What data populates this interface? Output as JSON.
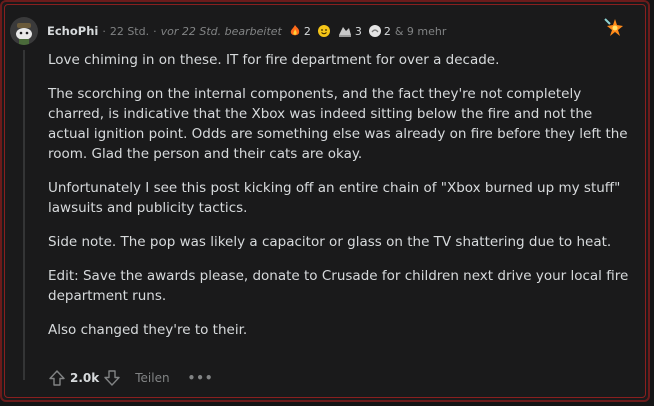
{
  "comment": {
    "username": "EchoPhi",
    "time": "22 Std.",
    "edited": "vor 22 Std. bearbeitet",
    "awards": [
      {
        "icon": "fire-award-icon",
        "count": "2"
      },
      {
        "icon": "wholesome-award-icon",
        "count": ""
      },
      {
        "icon": "helpful-award-icon",
        "count": "3"
      },
      {
        "icon": "silver-award-icon",
        "count": "2"
      }
    ],
    "more_awards": "& 9 mehr",
    "paragraphs": [
      "Love chiming in on these. IT for fire department for over a decade.",
      "The scorching on the internal components, and the fact they're not completely charred, is indicative that the Xbox was indeed sitting below the fire and not the actual ignition point. Odds are something else was already on fire before they left the room. Glad the person and their cats are okay.",
      "Unfortunately I see this post kicking off an entire chain of \"Xbox burned up my stuff\" lawsuits and publicity tactics.",
      "Side note. The pop was likely a capacitor or glass on the TV shattering due to heat.",
      "Edit: Save the awards please, donate to Crusade for children next drive your local fire department runs.",
      "Also changed they're to their."
    ],
    "score": "2.0k",
    "share_label": "Teilen",
    "more_label": "•••"
  },
  "colors": {
    "background": "#1a1a1b",
    "border": "#6b1b1b",
    "text": "#d7dadc",
    "muted": "#818384"
  }
}
